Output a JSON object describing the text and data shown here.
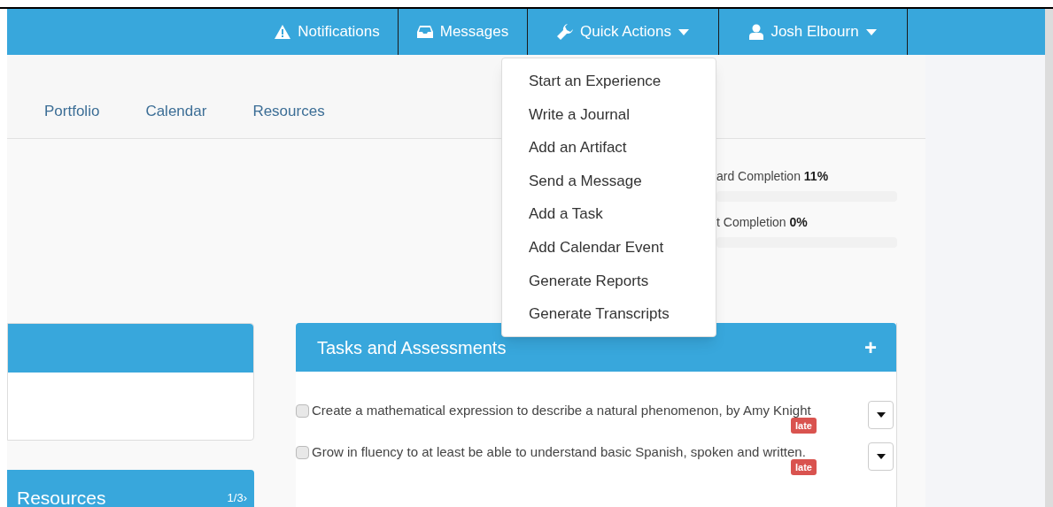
{
  "navbar": {
    "items": [
      {
        "kind": "alert",
        "label": "Notifications"
      },
      {
        "kind": "inbox",
        "label": "Messages"
      },
      {
        "kind": "wrench",
        "label": "Quick Actions",
        "caret": true
      },
      {
        "kind": "user",
        "label": "Josh Elbourn",
        "caret": true
      }
    ]
  },
  "subnav": {
    "links": [
      "Portfolio",
      "Calendar",
      "Resources"
    ]
  },
  "stats": [
    {
      "label": "ard Completion",
      "value": "11%"
    },
    {
      "label": "t Completion",
      "value": "0%"
    }
  ],
  "quick_actions_menu": [
    "Start an Experience",
    "Write a Journal",
    "Add an Artifact",
    "Send a Message",
    "Add a Task",
    "Add Calendar Event",
    "Generate Reports",
    "Generate Transcripts"
  ],
  "resources_panel": {
    "title": "Resources",
    "pager": "1/3›"
  },
  "tasks_panel": {
    "title": "Tasks and Assessments",
    "add": "+",
    "tasks": [
      {
        "text": "Create a mathematical expression to describe a natural phenomenon, by Amy Knight",
        "checked": false,
        "badge": "late"
      },
      {
        "text": "Grow in fluency to at least be able to understand basic Spanish, spoken and written.",
        "checked": false,
        "badge": "late"
      }
    ]
  }
}
